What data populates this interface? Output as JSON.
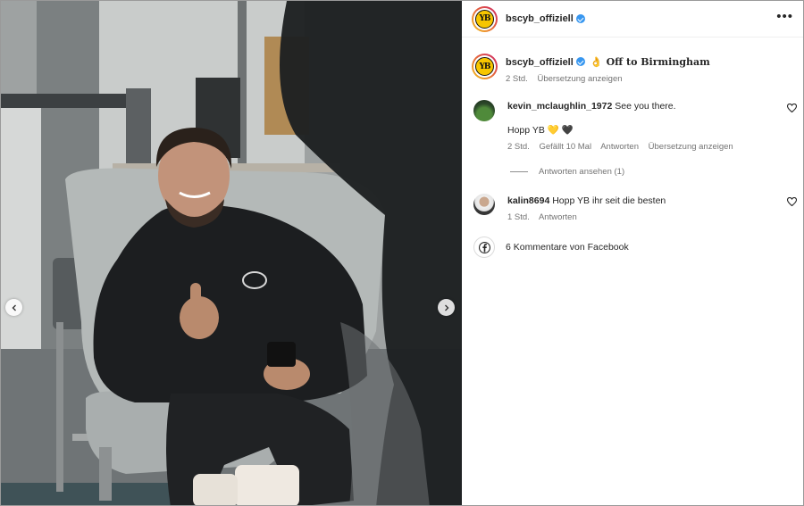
{
  "post": {
    "account": "bscyb_offiziell",
    "account_logo_text": "YB",
    "more_label": "•••",
    "caption": {
      "emoji": "👌",
      "text": "Off to Birmingham",
      "time": "2 Std.",
      "translate": "Übersetzung anzeigen"
    }
  },
  "comments": [
    {
      "user": "kevin_mclaughlin_1972",
      "text": "See you there.",
      "text2": "Hopp YB 💛 🖤",
      "time": "2 Std.",
      "likes": "Gefällt 10 Mal",
      "reply": "Antworten",
      "translate": "Übersetzung anzeigen",
      "view_replies": "Antworten ansehen (1)"
    },
    {
      "user": "kalin8694",
      "text": "Hopp YB ihr seit die besten",
      "time": "1 Std.",
      "reply": "Antworten"
    }
  ],
  "facebook": {
    "label": "6 Kommentare von Facebook"
  },
  "colors": {
    "verified": "#3897f0",
    "club_yellow": "#f7c600",
    "meta_gray": "#737373"
  },
  "icons": [
    "verified-badge-icon",
    "more-options-icon",
    "heart-icon",
    "facebook-icon",
    "chevron-left-icon",
    "chevron-right-icon"
  ]
}
